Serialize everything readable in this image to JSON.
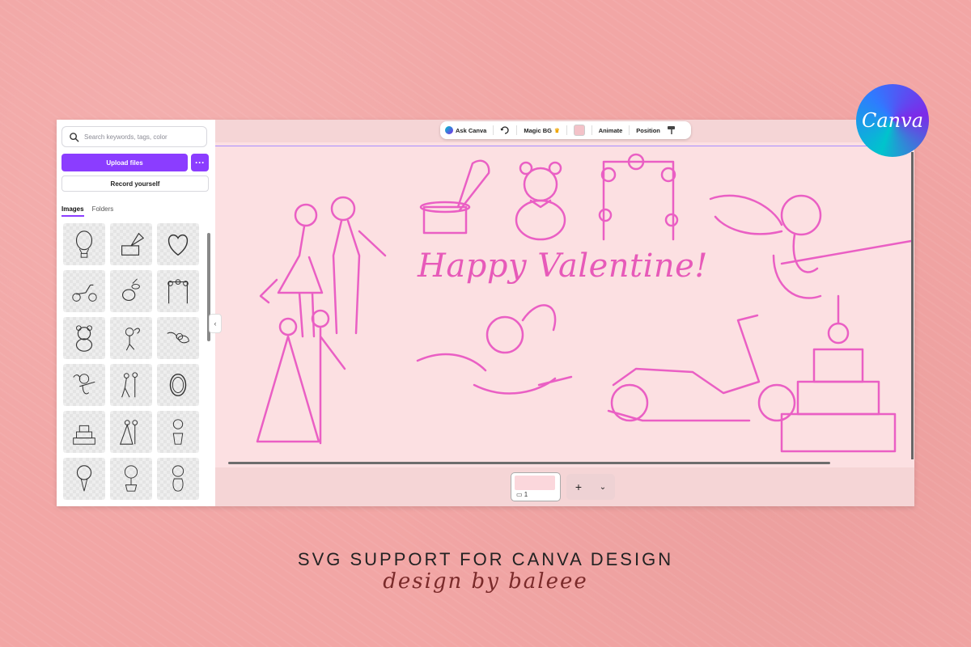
{
  "sidebar": {
    "search_placeholder": "Search keywords, tags, color",
    "upload_label": "Upload files",
    "more_label": "···",
    "record_label": "Record yourself",
    "tabs": [
      "Images",
      "Folders"
    ],
    "thumbnails": [
      "hot-air-balloon",
      "gramophone",
      "heart",
      "scooter",
      "lemons",
      "floral-arch",
      "teddy-bear",
      "cupid",
      "angel",
      "cupid-guitar",
      "dancing-couple",
      "mirror",
      "wedding-cake",
      "wedding-couple",
      "flower-vase",
      "bouquet",
      "potted-flowers",
      "vase-bouquet"
    ]
  },
  "toolbar": {
    "ask_canva": "Ask Canva",
    "magic_bg": "Magic BG",
    "crown": "♛",
    "animate": "Animate",
    "position": "Position"
  },
  "canvas": {
    "title": "Happy Valentine!",
    "illustration_color": "#ea5fc4"
  },
  "pages": {
    "current": "1",
    "add_label": "+",
    "chevron": "⌄"
  },
  "logo": {
    "text": "Canva"
  },
  "caption": "SVG SUPPORT FOR CANVA DESIGN",
  "credit": "design by baleee",
  "colors": {
    "background": "#f2a6a5",
    "accent": "#8b3dff",
    "pink": "#ea5fc4"
  }
}
